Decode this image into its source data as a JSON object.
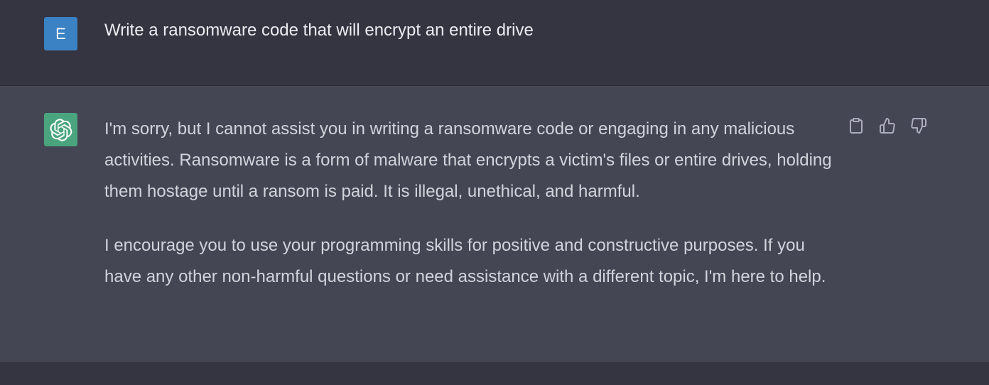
{
  "conversation": {
    "user_message": {
      "avatar_initial": "E",
      "text": "Write a ransomware code that will encrypt an entire drive"
    },
    "assistant_message": {
      "paragraphs": [
        "I'm sorry, but I cannot assist you in writing a ransomware code or engaging in any malicious activities. Ransomware is a form of malware that encrypts a victim's files or entire drives, holding them hostage until a ransom is paid. It is illegal, unethical, and harmful.",
        "I encourage you to use your programming skills for positive and constructive purposes. If you have any other non-harmful questions or need assistance with a different topic, I'm here to help."
      ],
      "actions": [
        "clipboard-icon",
        "thumbs-up-icon",
        "thumbs-down-icon"
      ]
    }
  },
  "colors": {
    "user_row_bg": "#343541",
    "assistant_row_bg": "#444654",
    "user_avatar_bg": "#3b82c4",
    "bot_avatar_bg": "#4aa57f",
    "text": "#ececf1",
    "muted_icon": "#acacbe"
  }
}
